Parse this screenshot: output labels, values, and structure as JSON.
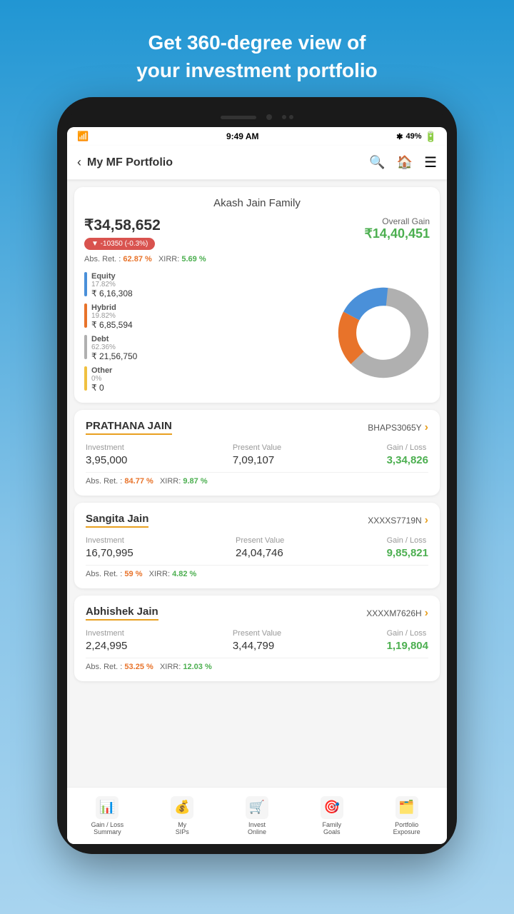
{
  "header": {
    "line1": "Get 360-degree view of",
    "line2": "your investment portfolio"
  },
  "status_bar": {
    "time": "9:49 AM",
    "battery": "49%",
    "bluetooth": "BT"
  },
  "app_bar": {
    "title": "My MF Portfolio"
  },
  "summary": {
    "family_name": "Akash Jain Family",
    "portfolio_value": "₹34,58,652",
    "change_label": "▼ -10350  (-0.3%)",
    "abs_ret_label": "Abs. Ret. :",
    "abs_ret_value": "62.87 %",
    "xirr_label": "XIRR:",
    "xirr_value": "5.69 %",
    "overall_gain_label": "Overall Gain",
    "overall_gain_value": "₹14,40,451"
  },
  "chart": {
    "segments": [
      {
        "name": "Equity",
        "pct": "17.82%",
        "color": "#4a90d9",
        "amount": "₹ 6,16,308",
        "value": 17.82
      },
      {
        "name": "Hybrid",
        "pct": "19.82%",
        "color": "#e8732a",
        "amount": "₹ 6,85,594",
        "value": 19.82
      },
      {
        "name": "Debt",
        "pct": "62.36%",
        "color": "#b0b0b0",
        "amount": "₹ 21,56,750",
        "value": 62.36
      },
      {
        "name": "Other",
        "pct": "0%",
        "color": "#f0c040",
        "amount": "₹ 0",
        "value": 0
      }
    ]
  },
  "members": [
    {
      "name": "PRATHANA JAIN",
      "pan": "BHAPS3065Y",
      "investment": "3,95,000",
      "present_value": "7,09,107",
      "gain_loss": "3,34,826",
      "abs_ret": "84.77 %",
      "xirr": "9.87 %"
    },
    {
      "name": "Sangita Jain",
      "pan": "XXXXS7719N",
      "investment": "16,70,995",
      "present_value": "24,04,746",
      "gain_loss": "9,85,821",
      "abs_ret": "59 %",
      "xirr": "4.82 %"
    },
    {
      "name": "Abhishek Jain",
      "pan": "XXXXM7626H",
      "investment": "2,24,995",
      "present_value": "3,44,799",
      "gain_loss": "1,19,804",
      "abs_ret": "53.25 %",
      "xirr": "12.03 %"
    }
  ],
  "bottom_nav": [
    {
      "id": "gain-loss",
      "label": "Gain / Loss\nSummary",
      "icon": "📊"
    },
    {
      "id": "my-sips",
      "label": "My\nSIPs",
      "icon": "💰"
    },
    {
      "id": "invest-online",
      "label": "Invest\nOnline",
      "icon": "🛒"
    },
    {
      "id": "family-goals",
      "label": "Family\nGoals",
      "icon": "🎯"
    },
    {
      "id": "portfolio-exposure",
      "label": "Portfolio\nExposure",
      "icon": "🗃️"
    }
  ]
}
